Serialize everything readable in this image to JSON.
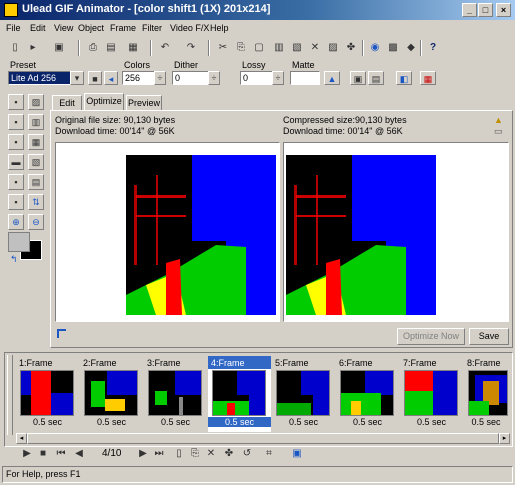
{
  "window": {
    "title": "Ulead GIF Animator - [color shift1 (1X) 201x214]"
  },
  "menu": [
    "File",
    "Edit",
    "View",
    "Object",
    "Frame",
    "Filter",
    "Video F/X",
    "Help"
  ],
  "optimize_bar": {
    "preset_label": "Preset",
    "preset_value": "Lite Ad 256",
    "colors_label": "Colors",
    "colors_value": "256",
    "dither_label": "Dither",
    "dither_value": "0",
    "lossy_label": "Lossy",
    "lossy_value": "0",
    "matte_label": "Matte"
  },
  "tabs": [
    "Edit",
    "Optimize",
    "Preview"
  ],
  "active_tab": "Optimize",
  "info": {
    "original_size": "Original file size:  90,130 bytes",
    "original_time": "Download time:   00'14\" @ 56K",
    "compressed_size": "Compressed size:90,130 bytes",
    "compressed_time": "Download time:   00'14\" @ 56K"
  },
  "buttons": {
    "optimize_now": "Optimize Now",
    "save": "Save"
  },
  "frames": [
    {
      "label": "1:Frame",
      "delay": "0.5 sec"
    },
    {
      "label": "2:Frame",
      "delay": "0.5 sec"
    },
    {
      "label": "3:Frame",
      "delay": "0.5 sec"
    },
    {
      "label": "4:Frame",
      "delay": "0.5 sec"
    },
    {
      "label": "5:Frame",
      "delay": "0.5 sec"
    },
    {
      "label": "6:Frame",
      "delay": "0.5 sec"
    },
    {
      "label": "7:Frame",
      "delay": "0.5 sec"
    },
    {
      "label": "8:Frame",
      "delay": "0.5 sec"
    }
  ],
  "selected_frame": 4,
  "playback": {
    "counter": "4/10"
  },
  "status": {
    "text": "For Help, press F1"
  },
  "colors": {
    "title_start": "#0a246a",
    "selection": "#3168c6",
    "preview_blue": "#0000ff",
    "preview_green": "#00cc00",
    "preview_red": "#ff0000"
  },
  "icons": [
    "minimize-icon",
    "maximize-icon",
    "close-icon",
    "play-icon",
    "stop-icon",
    "first-frame-icon",
    "prev-frame-icon",
    "next-frame-icon",
    "last-frame-icon",
    "help-icon"
  ]
}
